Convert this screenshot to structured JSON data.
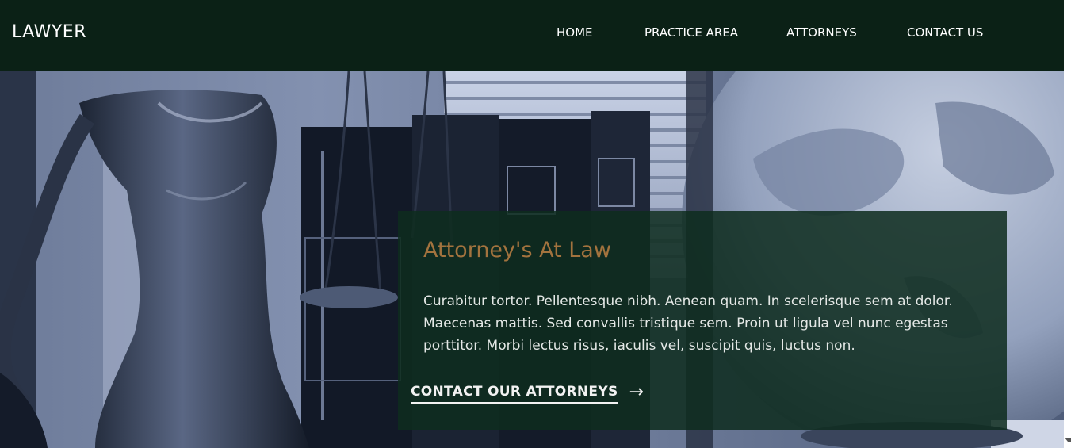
{
  "header": {
    "logo": "LAWYER",
    "nav": [
      {
        "label": "HOME"
      },
      {
        "label": "PRACTICE AREA"
      },
      {
        "label": "ATTORNEYS"
      },
      {
        "label": "CONTACT US"
      }
    ]
  },
  "hero": {
    "image": "statue-of-justice-books-globe-photo",
    "card": {
      "title": "Attorney's At Law",
      "body": "Curabitur tortor. Pellentesque nibh. Aenean quam. In scelerisque sem at dolor. Maecenas mattis. Sed convallis tristique sem. Proin ut ligula vel nunc egestas porttitor. Morbi lectus risus, iaculis vel, suscipit quis, luctus non.",
      "cta_label": "CONTACT OUR ATTORNEYS",
      "cta_icon": "arrow-right-icon"
    }
  },
  "colors": {
    "header_bg": "#0b2116",
    "card_bg": "#0e2c1e",
    "title_accent": "#a3733e",
    "text": "#ffffff"
  }
}
